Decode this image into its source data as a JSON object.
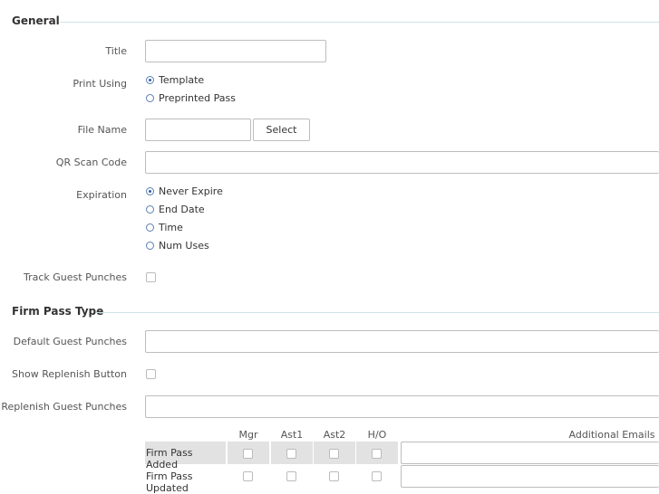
{
  "general": {
    "title": "General",
    "fields": {
      "title_label": "Title",
      "title_value": "",
      "print_using_label": "Print Using",
      "print_using_options": [
        "Template",
        "Preprinted Pass"
      ],
      "print_using_selected": "Template",
      "file_name_label": "File Name",
      "file_name_value": "",
      "select_button": "Select",
      "qr_label": "QR Scan Code",
      "qr_value": "",
      "expiration_label": "Expiration",
      "expiration_options": [
        "Never Expire",
        "End Date",
        "Time",
        "Num Uses"
      ],
      "expiration_selected": "Never Expire",
      "track_label": "Track Guest Punches"
    }
  },
  "firm": {
    "title": "Firm Pass Type",
    "default_label": "Default Guest Punches",
    "default_value": "",
    "show_replenish_label": "Show Replenish Button",
    "replenish_label": "Replenish Guest Punches",
    "replenish_value": "",
    "table": {
      "columns": [
        "Mgr",
        "Ast1",
        "Ast2",
        "H/O"
      ],
      "emails_header": "Additional Emails",
      "rows": [
        {
          "label": "Firm Pass Added",
          "email": ""
        },
        {
          "label": "Firm Pass Updated",
          "email": ""
        }
      ]
    }
  }
}
